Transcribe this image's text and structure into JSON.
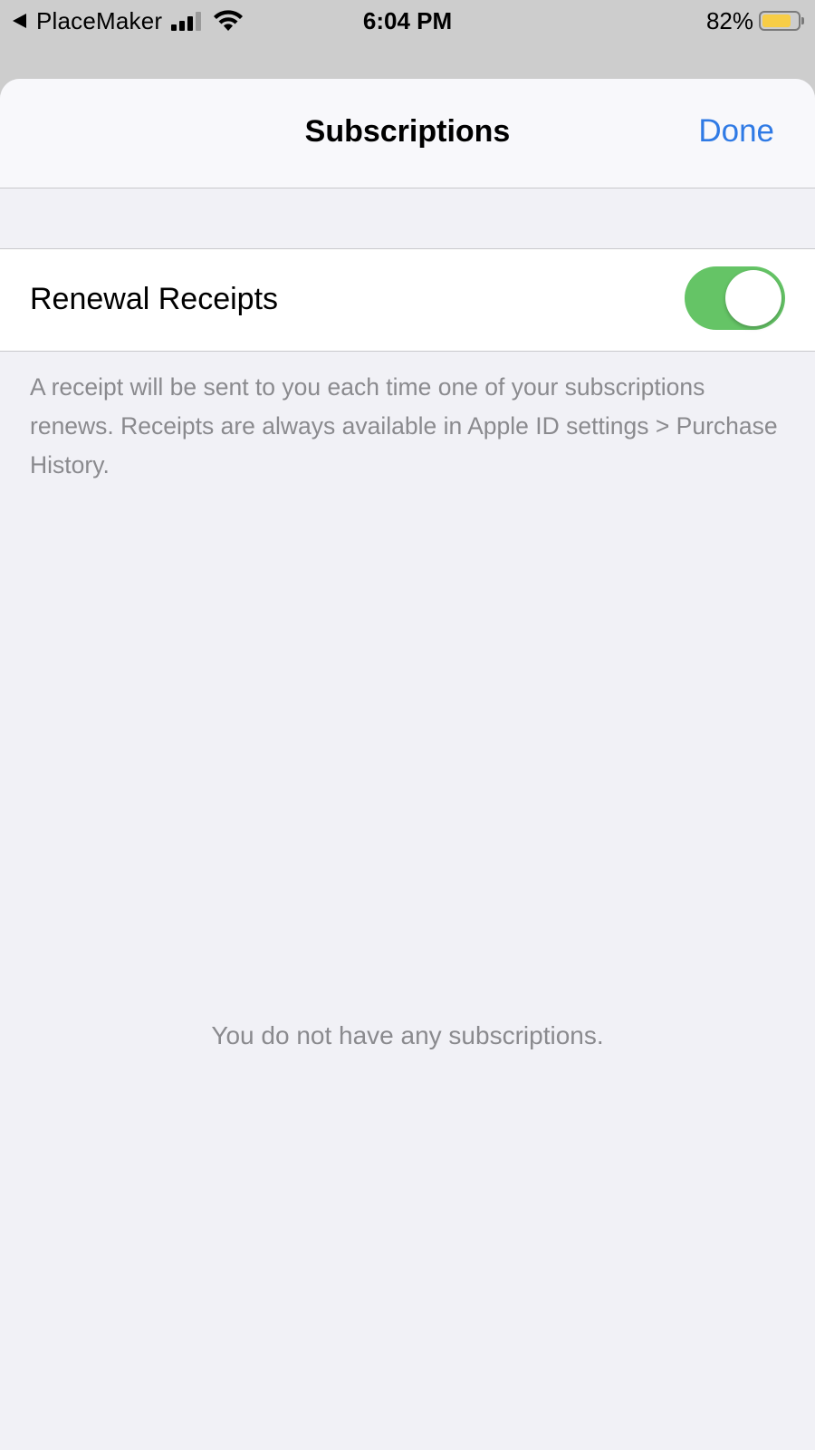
{
  "status_bar": {
    "back_app": "PlaceMaker",
    "time": "6:04 PM",
    "battery_percent": "82%",
    "battery_level": 0.82,
    "signal_bars_active": 3,
    "signal_bars_total": 4
  },
  "nav": {
    "title": "Subscriptions",
    "done_label": "Done"
  },
  "settings": {
    "renewal_receipts_label": "Renewal Receipts",
    "renewal_receipts_on": true,
    "footer": "A receipt will be sent to you each time one of your subscriptions renews. Receipts are always available in Apple ID settings > Purchase History."
  },
  "empty_state": {
    "message": "You do not have any subscriptions."
  },
  "colors": {
    "accent": "#2f7ae5",
    "toggle_on": "#65c466",
    "battery": "#f7cd46",
    "secondary_text": "#8a8a8e",
    "grouped_background": "#f1f1f6"
  }
}
